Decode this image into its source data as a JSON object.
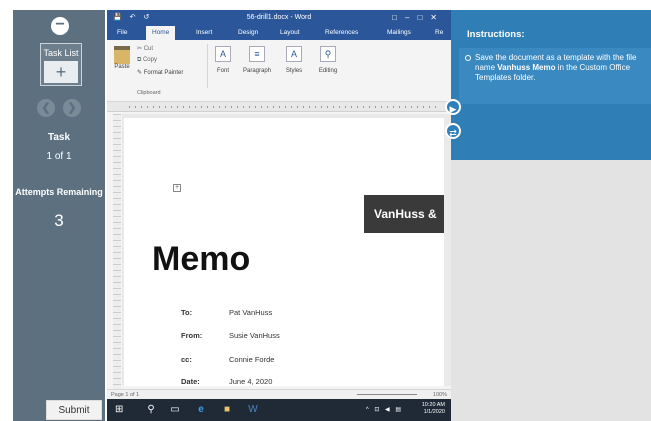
{
  "sidebar": {
    "collapse_icon": "minus-icon",
    "task_list_label": "Task List",
    "task_list_icon": "plus-icon",
    "prev_icon": "chevron-left-icon",
    "next_icon": "chevron-right-icon",
    "task_label": "Task",
    "task_value": "1 of 1",
    "attempts_label": "Attempts Remaining",
    "attempts_value": "3",
    "submit_label": "Submit"
  },
  "word": {
    "title": "56-drill1.docx - Word",
    "tabs": [
      {
        "label": "File"
      },
      {
        "label": "Home"
      },
      {
        "label": "Insert"
      },
      {
        "label": "Design"
      },
      {
        "label": "Layout"
      },
      {
        "label": "References"
      },
      {
        "label": "Mailings"
      },
      {
        "label": "Re"
      }
    ],
    "ribbon": {
      "paste": "Paste",
      "cut": "Cut",
      "copy": "Copy",
      "format_painter": "Format Painter",
      "clipboard": "Clipboard",
      "font": "Font",
      "paragraph": "Paragraph",
      "styles": "Styles",
      "editing": "Editing"
    },
    "document": {
      "banner": "VanHuss &",
      "heading": "Memo",
      "fields": [
        {
          "key": "To:",
          "value": "Pat VanHuss"
        },
        {
          "key": "From:",
          "value": "Susie VanHuss"
        },
        {
          "key": "cc:",
          "value": "Connie Forde"
        },
        {
          "key": "Date:",
          "value": "June 4, 2020"
        }
      ]
    },
    "status": {
      "page": "Page 1 of 1",
      "zoom": "100%"
    },
    "taskbar": {
      "time": "10:20 AM",
      "date": "1/1/2020"
    }
  },
  "instructions": {
    "title": "Instructions:",
    "text_pre": "Save the document as a template with the file name ",
    "text_bold": "Vanhuss Memo",
    "text_post": " in the Custom Office Templates folder."
  },
  "colors": {
    "sidebar": "#5c7080",
    "word_blue": "#2b579a",
    "instructions_blue": "#2f7fb6",
    "gray_panel": "#e3e3e3"
  }
}
